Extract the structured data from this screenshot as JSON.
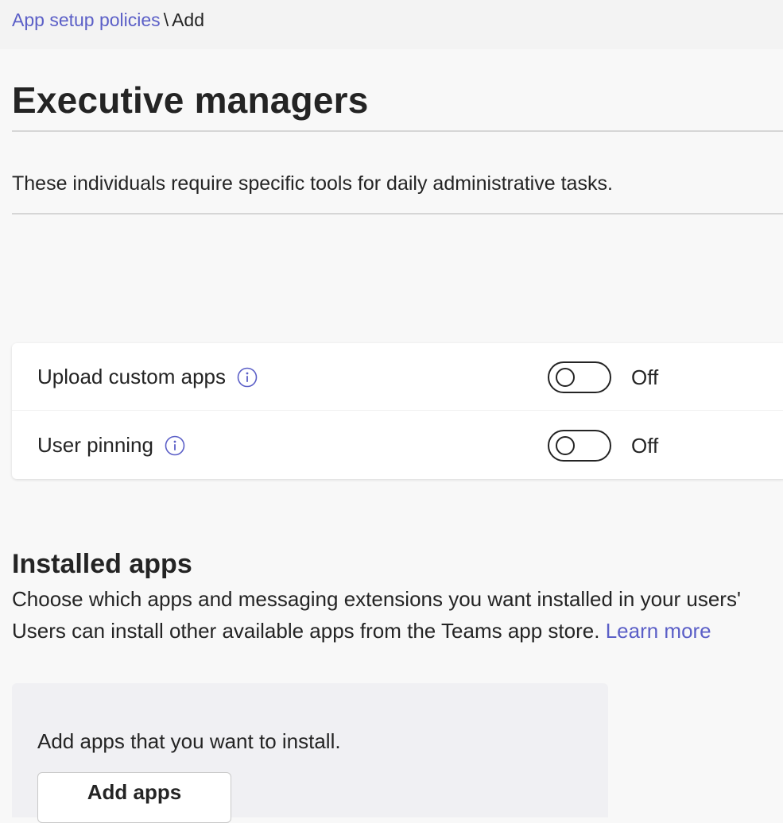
{
  "breadcrumb": {
    "parent": "App setup policies",
    "separator": "\\",
    "current": "Add"
  },
  "page": {
    "title": "Executive managers",
    "description": "These individuals require specific tools for daily administrative tasks."
  },
  "settings": [
    {
      "label": "Upload custom apps",
      "state": "Off",
      "enabled": false,
      "icon": "info-icon"
    },
    {
      "label": "User pinning",
      "state": "Off",
      "enabled": false,
      "icon": "info-icon"
    }
  ],
  "installed_apps": {
    "heading": "Installed apps",
    "description_line1": "Choose which apps and messaging extensions you want installed in your users'",
    "description_line2": "Users can install other available apps from the Teams app store.",
    "learn_more": "Learn more",
    "panel_text": "Add apps that you want to install.",
    "add_button": "Add apps"
  },
  "colors": {
    "accent": "#5b5fc7",
    "text": "#242424",
    "background": "#f8f8f8"
  }
}
